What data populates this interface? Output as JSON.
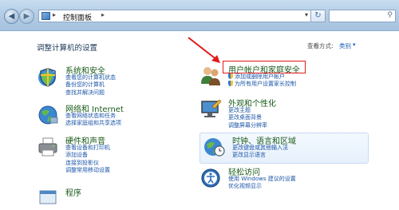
{
  "window": {
    "breadcrumb": "控制面板",
    "search_placeholder": ""
  },
  "header": {
    "page_title": "调整计算机的设置",
    "view_by_label": "查看方式:",
    "view_by_value": "类别"
  },
  "categories": [
    {
      "title": "系统和安全",
      "icon": "shield-globe-icon",
      "links": [
        "查看您的计算机状态",
        "备份您的计算机",
        "查找并解决问题"
      ],
      "shielded": []
    },
    {
      "title": "用户帐户和家庭安全",
      "icon": "users-icon",
      "links": [
        "添加或删除用户帐户",
        "为所有用户设置家长控制"
      ],
      "shielded": [
        0,
        1
      ]
    },
    {
      "title": "网络和 Internet",
      "icon": "network-globe-icon",
      "links": [
        "查看网络状态和任务",
        "选择家庭组和共享选项"
      ],
      "shielded": []
    },
    {
      "title": "外观和个性化",
      "icon": "monitor-palette-icon",
      "links": [
        "更改主题",
        "更改桌面背景",
        "调整屏幕分辨率"
      ],
      "shielded": []
    },
    {
      "title": "硬件和声音",
      "icon": "printer-icon",
      "links": [
        "查看设备和打印机",
        "添加设备",
        "连接到投影仪",
        "调整常用移动设置"
      ],
      "shielded": []
    },
    {
      "title": "时钟、语言和区域",
      "icon": "clock-globe-icon",
      "links": [
        "更改键盘或其他输入法",
        "更改显示语言"
      ],
      "shielded": []
    },
    {
      "title": "程序",
      "icon": "programs-icon",
      "links": [],
      "shielded": []
    },
    {
      "title": "轻松访问",
      "icon": "ease-of-access-icon",
      "links": [
        "使用 Windows 建议的设置",
        "优化视频显示"
      ],
      "shielded": []
    }
  ],
  "colors": {
    "link": "#1c56a8",
    "category_title": "#1a5b1a",
    "annotation_red": "#e01a1a"
  }
}
